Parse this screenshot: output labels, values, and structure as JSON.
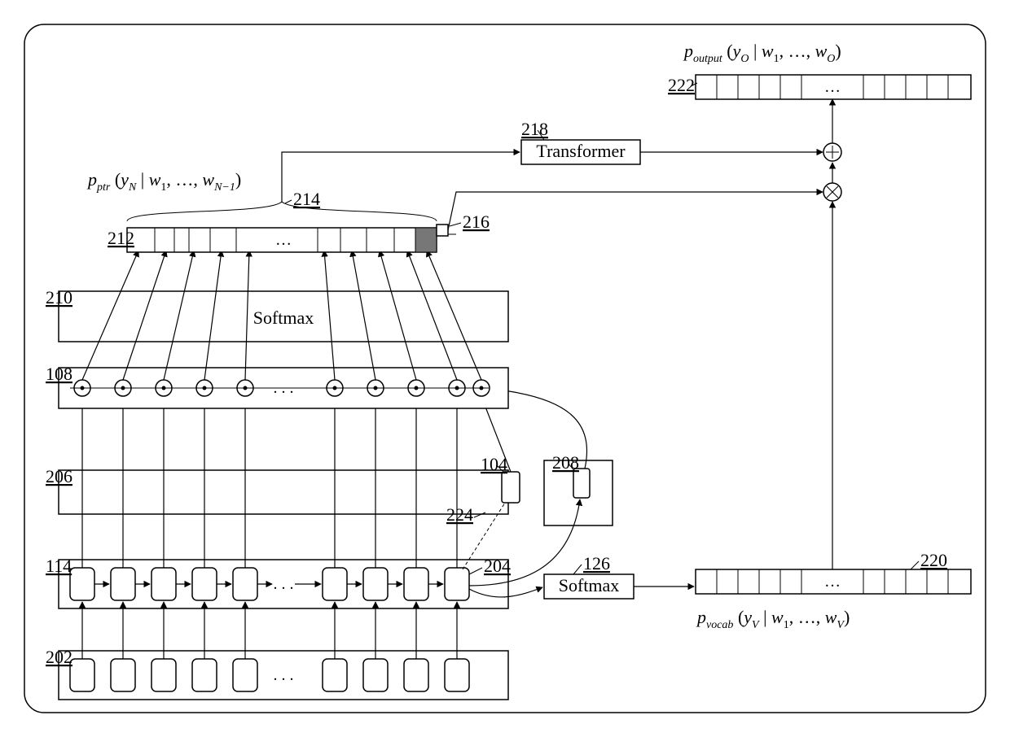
{
  "refs": {
    "r108": "108",
    "r114": "114",
    "r126": "126",
    "r104": "104",
    "r202": "202",
    "r204": "204",
    "r206": "206",
    "r208": "208",
    "r210": "210",
    "r212": "212",
    "r214": "214",
    "r216": "216",
    "r218": "218",
    "r220": "220",
    "r222": "222",
    "r224": "224"
  },
  "labels": {
    "softmax_top": "Softmax",
    "softmax_right": "Softmax",
    "transformer": "Transformer",
    "ellipsis": "…",
    "ellipsis3": ". . ."
  },
  "formulae": {
    "p_ptr_pre": "p",
    "p_ptr_sub": "ptr",
    "p_ptr_args_open": " (",
    "p_ptr_y": "y",
    "p_ptr_N": "N",
    "p_ptr_mid": " | ",
    "p_ptr_w1": "w",
    "p_ptr_1": "1",
    "p_ptr_comma": ", …, ",
    "p_ptr_wN1": "w",
    "p_ptr_Nm1": "N−1",
    "p_ptr_close": ")",
    "p_out_pre": "p",
    "p_out_sub": "output",
    "p_out_args_open": " (",
    "p_out_y": "y",
    "p_out_O": "O",
    "p_out_mid": " | ",
    "p_out_w1": "w",
    "p_out_1": "1",
    "p_out_comma": ", …, ",
    "p_out_wO": "w",
    "p_out_Osub": "O",
    "p_out_close": ")",
    "p_voc_pre": "p",
    "p_voc_sub": "vocab",
    "p_voc_args_open": " (",
    "p_voc_y": "y",
    "p_voc_V": "V",
    "p_voc_mid": " | ",
    "p_voc_w1": "w",
    "p_voc_1": "1",
    "p_voc_comma": ", …, ",
    "p_voc_wV": "w",
    "p_voc_Vsub": "V",
    "p_voc_close": ")"
  }
}
